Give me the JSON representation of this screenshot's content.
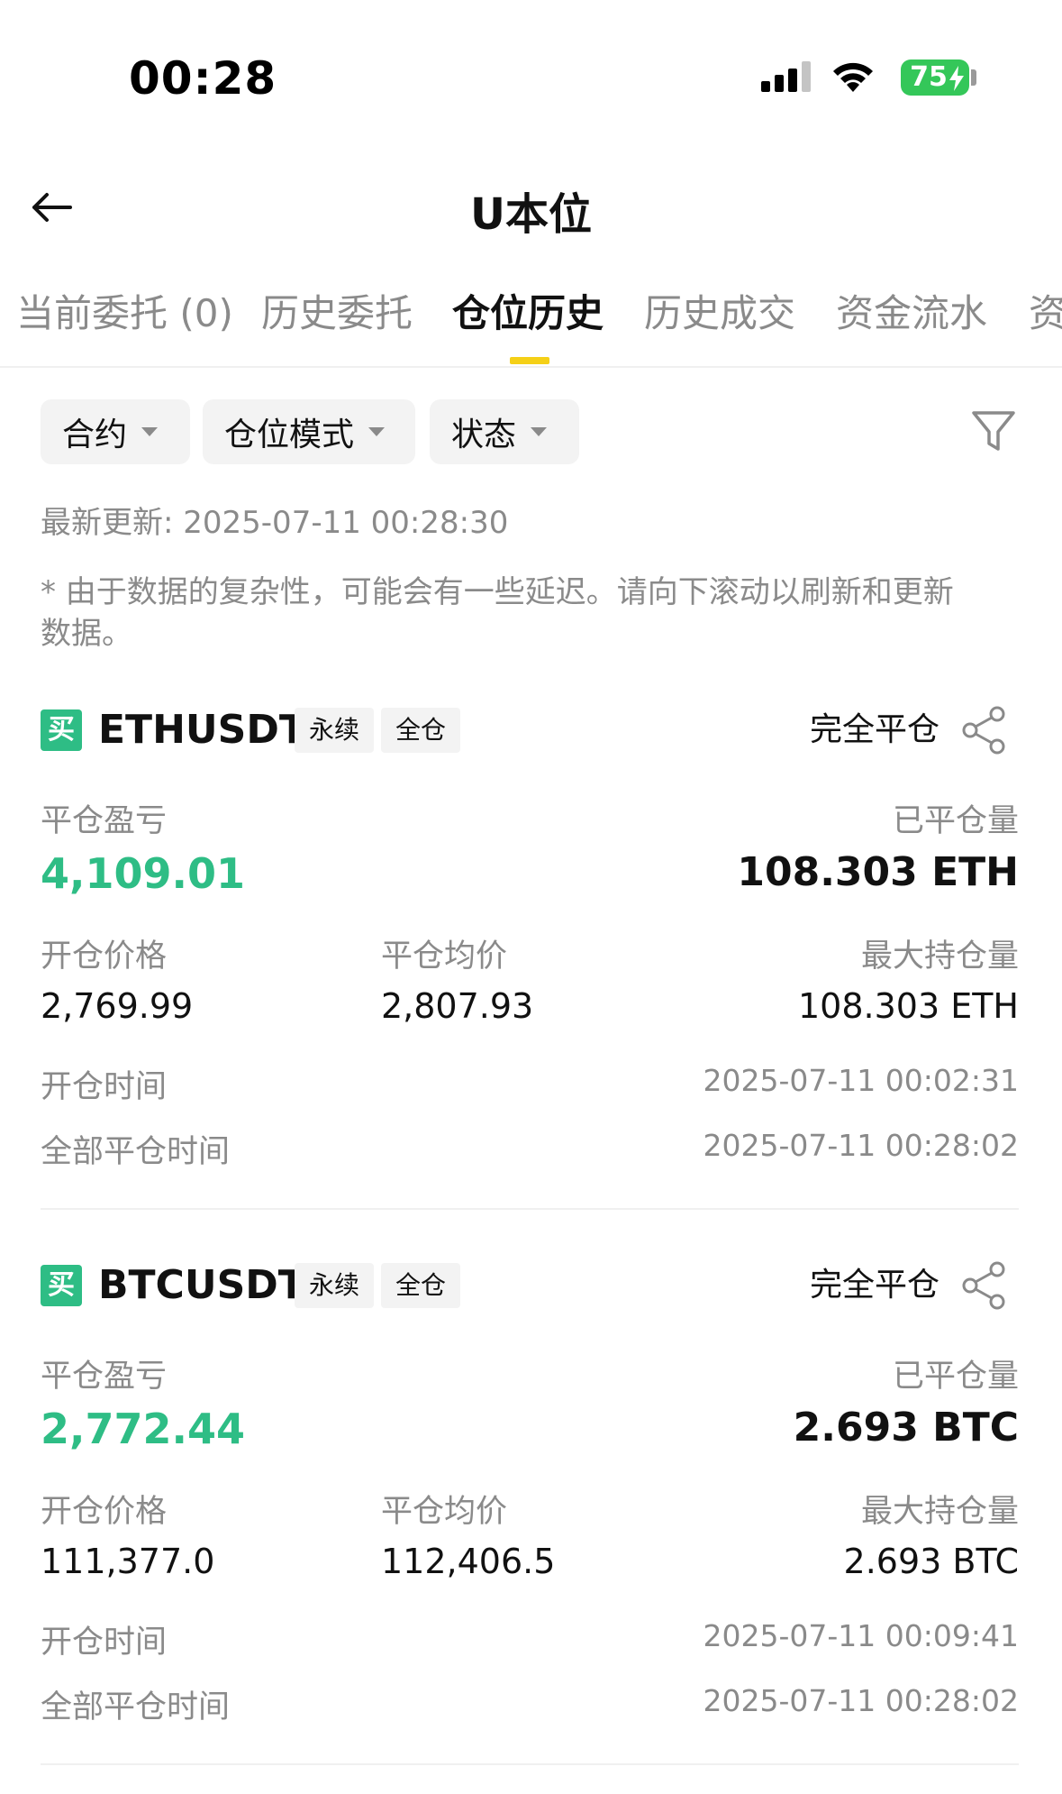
{
  "status_bar": {
    "time": "00:28",
    "battery": "75"
  },
  "header": {
    "title": "U本位"
  },
  "tabs": [
    {
      "label": "当前委托 (0)"
    },
    {
      "label": "历史委托"
    },
    {
      "label": "仓位历史"
    },
    {
      "label": "历史成交"
    },
    {
      "label": "资金流水"
    },
    {
      "label": "资"
    }
  ],
  "filters": [
    {
      "label": "合约"
    },
    {
      "label": "仓位模式"
    },
    {
      "label": "状态"
    }
  ],
  "last_updated": "最新更新: 2025-07-11 00:28:30",
  "disclaimer": "* 由于数据的复杂性，可能会有一些延迟。请向下滚动以刷新和更新数据。",
  "labels": {
    "realized_pnl": "平仓盈亏",
    "closed_qty": "已平仓量",
    "entry_price": "开仓价格",
    "avg_close_price": "平仓均价",
    "max_position": "最大持仓量",
    "open_time": "开仓时间",
    "full_close_time": "全部平仓时间"
  },
  "positions": [
    {
      "side": "买",
      "symbol": "ETHUSDT",
      "contract_type": "永续",
      "margin_mode": "全仓",
      "status": "完全平仓",
      "realized_pnl": "4,109.01",
      "closed_qty": "108.303 ETH",
      "entry_price": "2,769.99",
      "avg_close_price": "2,807.93",
      "max_position": "108.303 ETH",
      "open_time": "2025-07-11 00:02:31",
      "full_close_time": "2025-07-11 00:28:02"
    },
    {
      "side": "买",
      "symbol": "BTCUSDT",
      "contract_type": "永续",
      "margin_mode": "全仓",
      "status": "完全平仓",
      "realized_pnl": "2,772.44",
      "closed_qty": "2.693 BTC",
      "entry_price": "111,377.0",
      "avg_close_price": "112,406.5",
      "max_position": "2.693 BTC",
      "open_time": "2025-07-11 00:09:41",
      "full_close_time": "2025-07-11 00:28:02"
    }
  ],
  "colors": {
    "profit": "#2ebd85",
    "accent": "#f5d017",
    "muted": "#8a8a8a"
  }
}
